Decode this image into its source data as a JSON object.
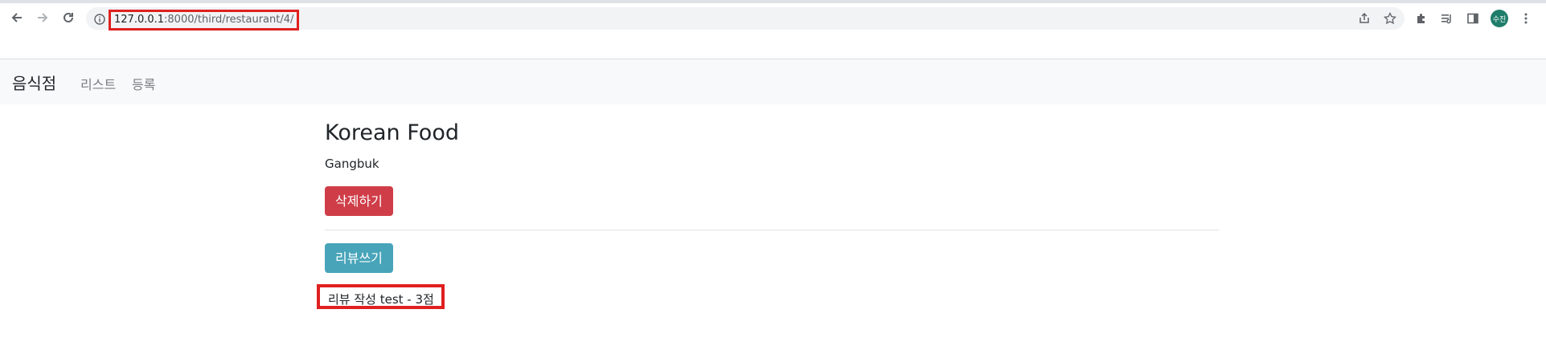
{
  "browser": {
    "url_host": "127.0.0.1",
    "url_path": ":8000/third/restaurant/4/",
    "profile_initials": "수진",
    "icons": [
      "back-icon",
      "forward-icon",
      "reload-icon",
      "info-icon",
      "share-icon",
      "star-icon",
      "extensions-icon",
      "media-icon",
      "sidepanel-icon",
      "menu-icon"
    ]
  },
  "navbar": {
    "brand": "음식점",
    "links": [
      "리스트",
      "등록"
    ]
  },
  "restaurant": {
    "name": "Korean Food",
    "location": "Gangbuk",
    "delete_label": "삭제하기",
    "review_button_label": "리뷰쓰기"
  },
  "reviews": [
    {
      "text": "리뷰 작성 test - 3점"
    }
  ],
  "colors": {
    "danger": "#cf3e48",
    "info": "#48a4b9",
    "highlight": "#e02020",
    "navbar_bg": "#f8f9fa"
  }
}
